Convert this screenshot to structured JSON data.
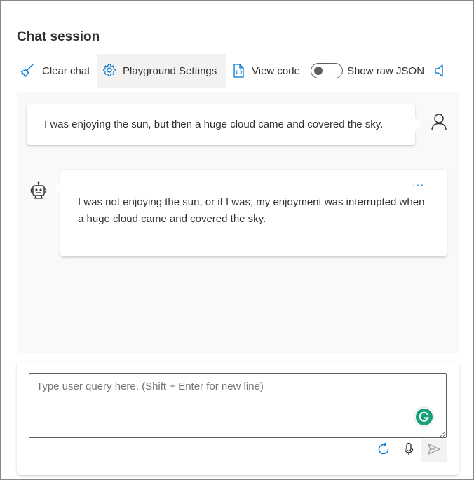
{
  "page": {
    "title": "Chat session"
  },
  "toolbar": {
    "clear_label": "Clear chat",
    "settings_label": "Playground Settings",
    "code_label": "View code",
    "raw_json_label": "Show raw JSON",
    "raw_json_on": false
  },
  "messages": [
    {
      "role": "user",
      "text": "I was enjoying the sun, but then a huge cloud came and covered the sky."
    },
    {
      "role": "assistant",
      "text": "I was not enjoying the sun, or if I was, my enjoyment was interrupted when a huge cloud came and covered the sky.",
      "more": "···"
    }
  ],
  "input": {
    "placeholder": "Type user query here. (Shift + Enter for new line)",
    "value": ""
  },
  "icons": {
    "clear": "broom-icon",
    "settings": "gear-icon",
    "code": "code-file-icon",
    "speaker": "speaker-icon",
    "user": "person-icon",
    "bot": "bot-icon",
    "grammarly": "grammarly-icon",
    "refresh": "refresh-icon",
    "mic": "microphone-icon",
    "send": "send-icon"
  },
  "colors": {
    "accent": "#0078d4",
    "grammarly": "#15c39a"
  }
}
